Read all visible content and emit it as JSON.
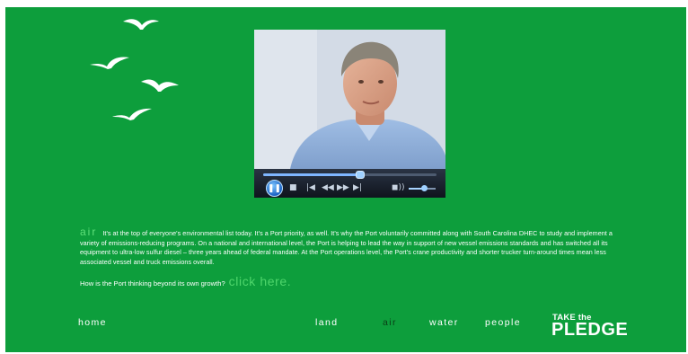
{
  "colors": {
    "background": "#0d9e3c",
    "accent_text": "#5fe07a",
    "active_nav": "#0a3d16",
    "player_chrome": "#1c2330"
  },
  "icons": {
    "decoration": "seagull-icon",
    "play_pause": "pause-icon",
    "stop": "stop-icon",
    "previous": "previous-icon",
    "rewind": "rewind-icon",
    "fast_forward": "fast-forward-icon",
    "next": "next-icon",
    "volume": "speaker-icon"
  },
  "player": {
    "seek_progress": 0.56,
    "volume_level": 0.55
  },
  "content": {
    "section_label": "air",
    "body": "It's at the top of everyone's environmental list today. It's a Port priority, as well. It's why the Port voluntarily committed along with South Carolina DHEC to study and implement a variety of emissions-reducing programs. On a national and international level, the Port is helping to lead the way in support of new vessel emissions standards and has switched all its equipment to ultra-low sulfur diesel – three years ahead of federal mandate. At the Port operations level, the Port's crane productivity and shorter trucker turn-around times mean less associated vessel and truck emissions overall.",
    "question": "How is the Port thinking beyond its own growth?",
    "cta": "click here."
  },
  "nav": {
    "home": "home",
    "land": "land",
    "air": "air",
    "water": "water",
    "people": "people"
  },
  "pledge": {
    "line1": "TAKE the",
    "line2": "PLEDGE"
  }
}
